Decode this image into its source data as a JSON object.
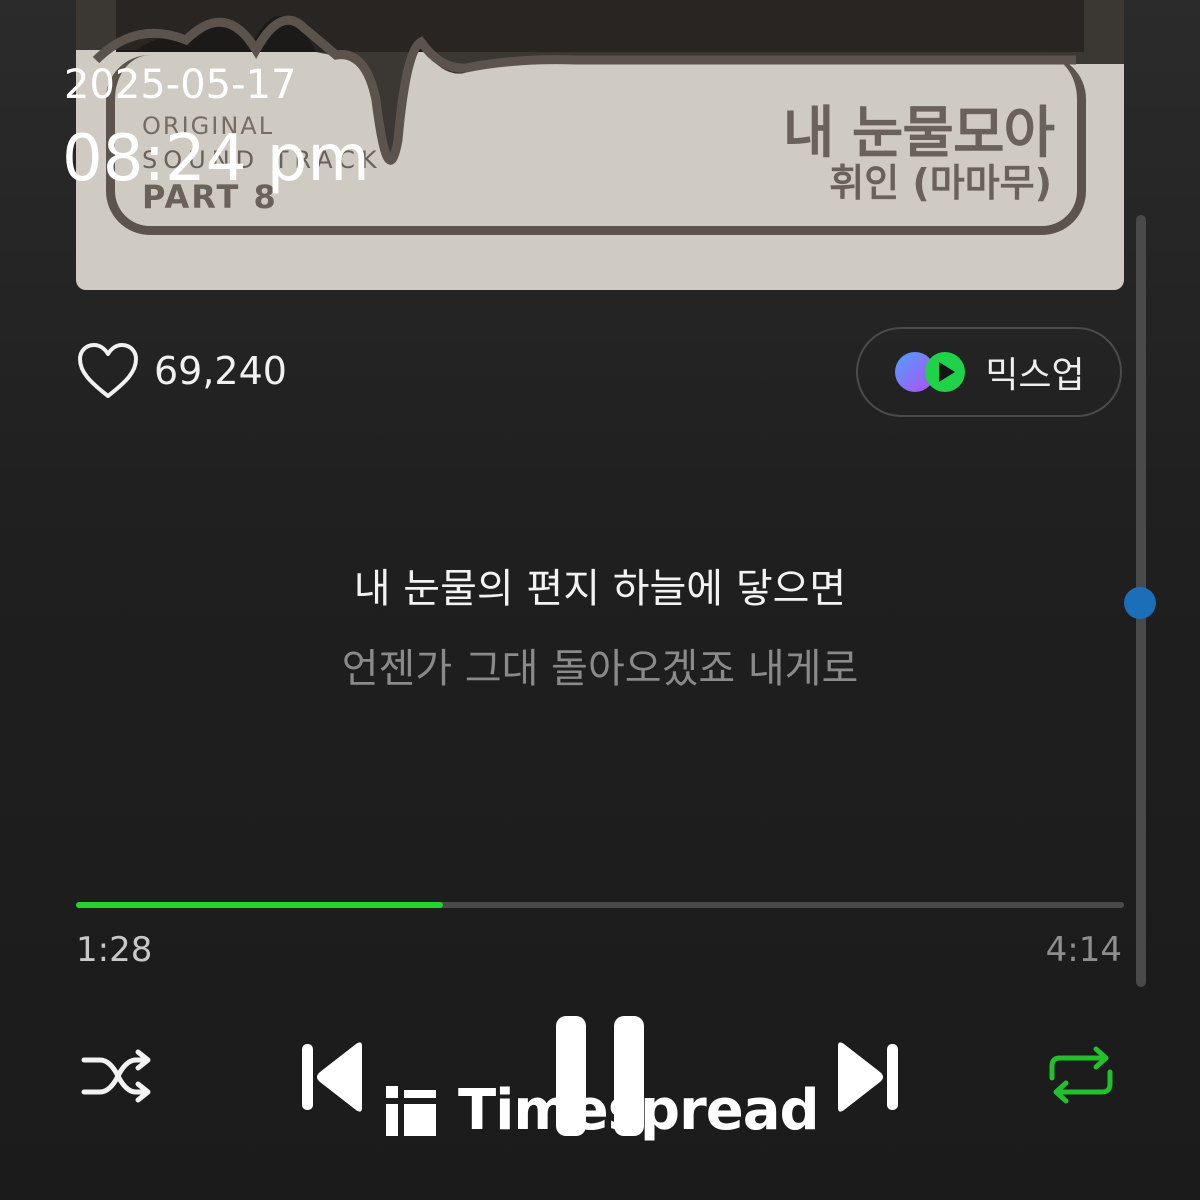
{
  "album_art": {
    "title": "내 눈물모아",
    "artist": "휘인 (마마무)",
    "ost_line1": "ORIGINAL",
    "ost_line2": "SOUND TRACK",
    "ost_line3": "PART 8"
  },
  "overlay": {
    "date": "2025-05-17",
    "time": "08:24 pm"
  },
  "like": {
    "count": "69,240",
    "icon": "heart-icon"
  },
  "mixup": {
    "label": "믹스업",
    "icon": "mixup-logo-icon"
  },
  "lyrics": {
    "current": "내 눈물의 편지 하늘에 닿으면",
    "next": "언젠가 그대 돌아오겠죠 내게로"
  },
  "playback": {
    "elapsed": "1:28",
    "total": "4:14",
    "progress_fraction": 0.35,
    "progress_color": "#22d42c"
  },
  "controls": {
    "shuffle": "shuffle-icon",
    "previous": "previous-track-icon",
    "pause": "pause-icon",
    "next": "next-track-icon",
    "repeat": "repeat-icon",
    "repeat_color": "#22c02c"
  },
  "watermark": {
    "text": "Timespread"
  }
}
